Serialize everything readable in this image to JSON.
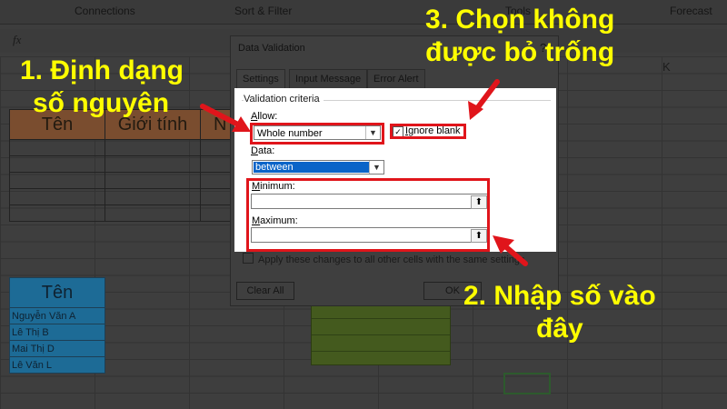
{
  "ribbon": {
    "groups": [
      "Connections",
      "Sort & Filter",
      "Tools",
      "Forecast"
    ]
  },
  "formula_bar": {
    "fx": "fx"
  },
  "grid": {
    "column_letter": "K"
  },
  "table1": {
    "headers": [
      "Tên",
      "Giới tính",
      "N"
    ]
  },
  "table2": {
    "header": "Tên",
    "rows": [
      "Nguyễn Văn A",
      "Lê Thị B",
      "Mai Thị D",
      "Lê Văn L"
    ]
  },
  "dialog": {
    "title": "Data Validation",
    "help": "?",
    "tabs": [
      "Settings",
      "Input Message",
      "Error Alert"
    ],
    "criteria_label": "Validation criteria",
    "allow_label_underlined": "A",
    "allow_label_rest": "llow:",
    "allow_value": "Whole number",
    "data_label_underlined": "D",
    "data_label_rest": "ata:",
    "data_value": "between",
    "ignore_blank_underlined": "I",
    "ignore_blank_rest": "gnore blank",
    "minimum_label_underlined": "M",
    "minimum_label_rest": "inimum:",
    "maximum_label_underlined": "M",
    "maximum_label_rest": "aximum:",
    "minimum_value": "",
    "maximum_value": "",
    "apply_label": "Apply these changes to all other cells with the same settings",
    "clear_all": "Clear All",
    "ok": "OK"
  },
  "annotations": {
    "step1_line1": "1. Định dạng",
    "step1_line2": "số nguyên",
    "step2_line1": "2. Nhập số vào",
    "step2_line2": "đây",
    "step3_line1": "3. Chọn không",
    "step3_line2": "được bỏ trống"
  },
  "colors": {
    "annotation": "#ffff00",
    "highlight_box": "#e0151b"
  }
}
